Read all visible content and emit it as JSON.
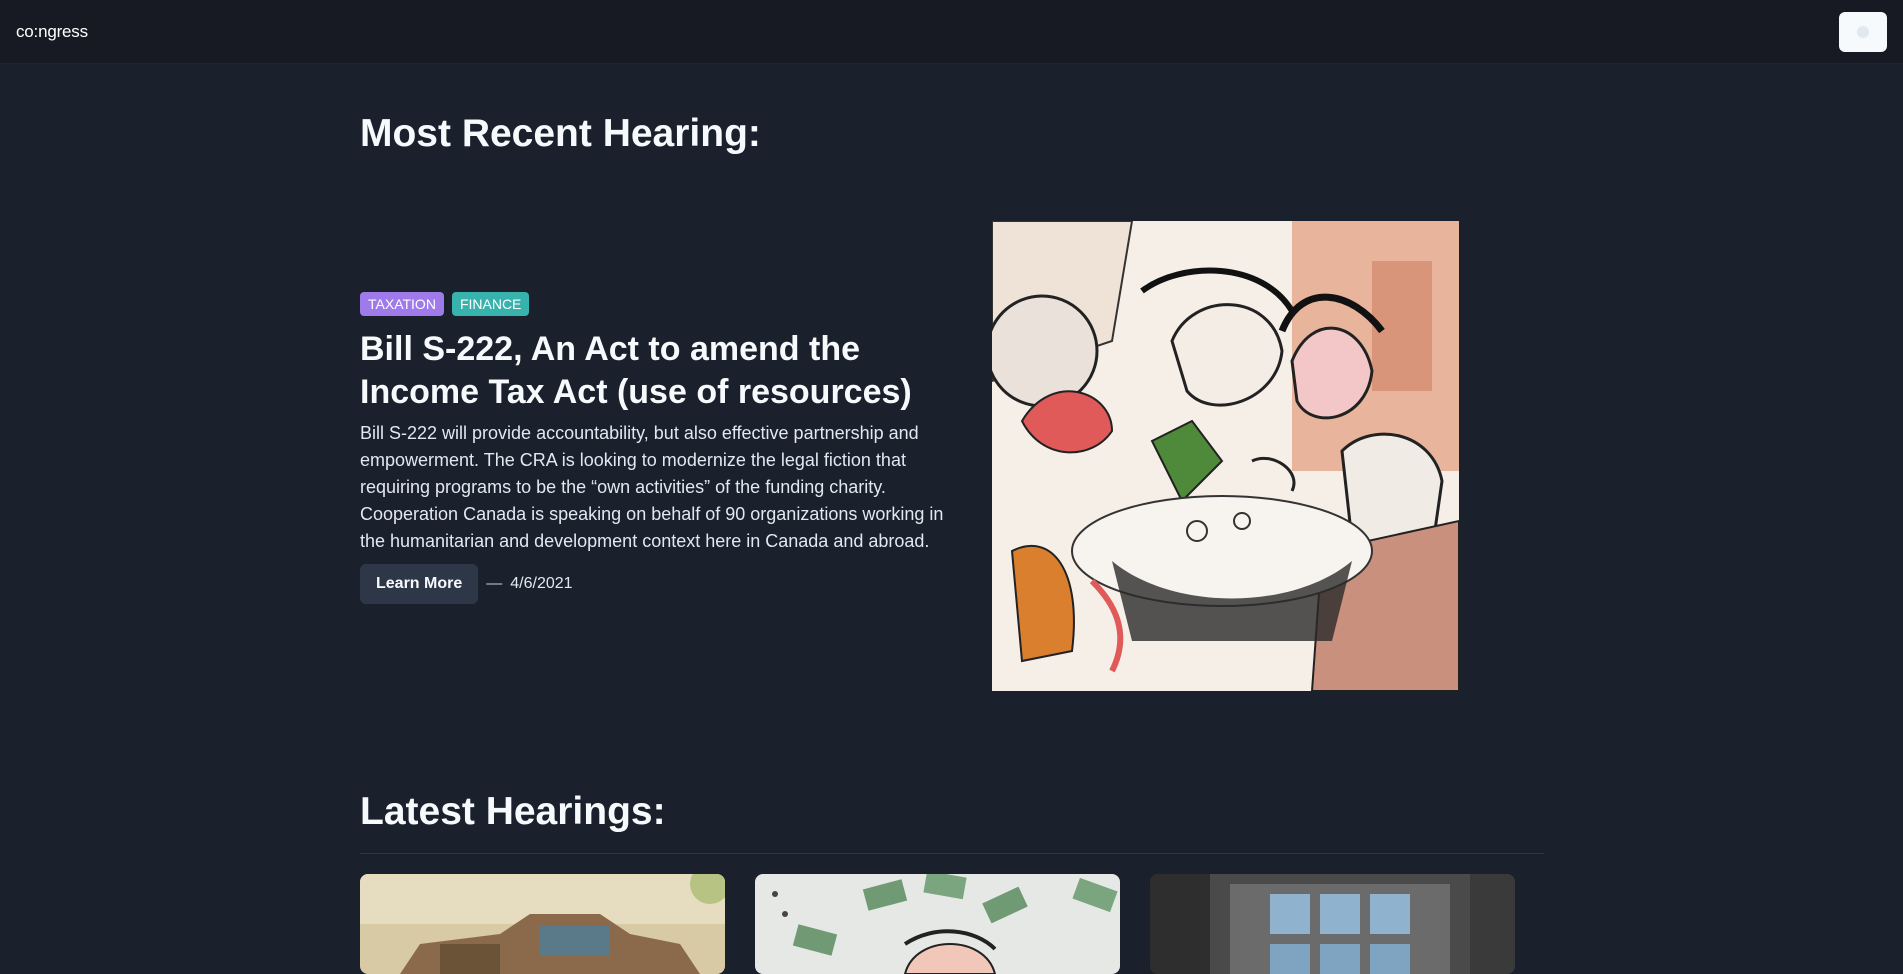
{
  "app": {
    "logo": "co:ngress"
  },
  "recent": {
    "section_title": "Most Recent Hearing:",
    "tags": [
      "TAXATION",
      "FINANCE"
    ],
    "title": "Bill S-222, An Act to amend the Income Tax Act (use of resources)",
    "description": "Bill S-222 will provide accountability, but also effective partnership and empowerment. The CRA is looking to modernize the legal fiction that requiring programs to be the “own activities” of the funding charity. Cooperation Canada is speaking on behalf of 90 organizations working in the humanitarian and development context here in Canada and abroad.",
    "learn_more": "Learn More",
    "dash": "—",
    "date": "4/6/2021"
  },
  "latest": {
    "section_title": "Latest Hearings:"
  },
  "colors": {
    "background": "#1a202c",
    "topbar": "#171923",
    "tag_taxation": "#9f7aea",
    "tag_finance": "#38b2ac",
    "button": "#2d3748"
  },
  "icons": {
    "theme_toggle": "sun-icon"
  }
}
